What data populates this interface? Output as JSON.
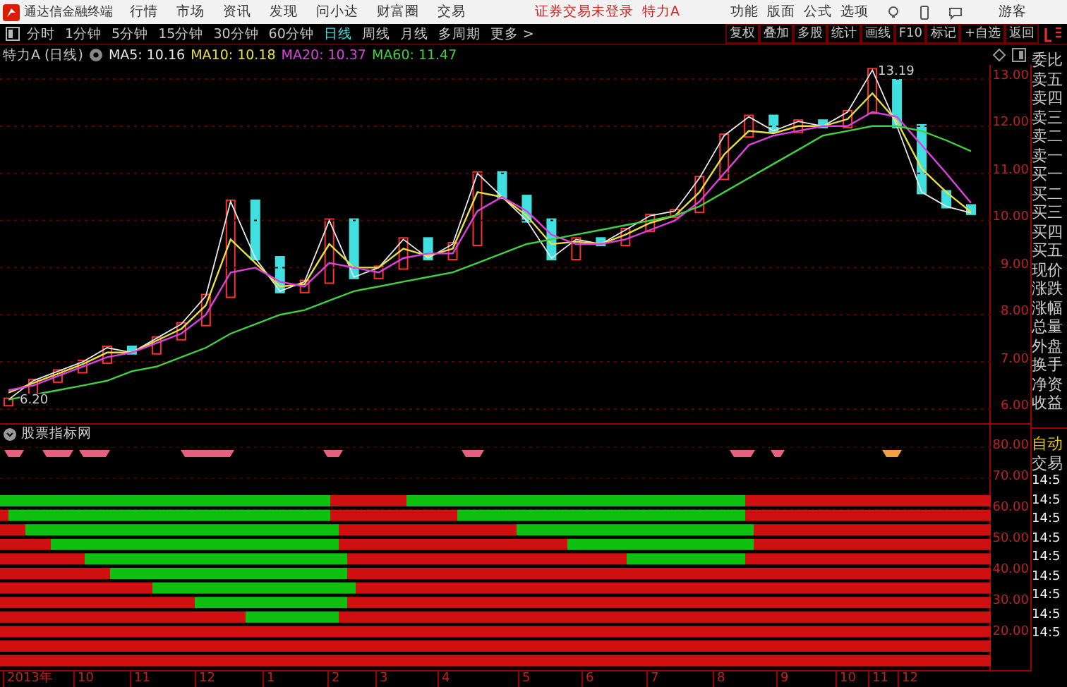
{
  "app": {
    "title": "通达信金融终端"
  },
  "menu": [
    "行情",
    "市场",
    "资讯",
    "发现",
    "问小达",
    "财富圈",
    "交易"
  ],
  "login_notice": "证券交易未登录",
  "stock_name": "特力A",
  "top_actions": [
    "功能",
    "版面",
    "公式",
    "选项"
  ],
  "user": "游客",
  "periods": [
    {
      "label": "分时",
      "selected": false
    },
    {
      "label": "1分钟",
      "selected": false
    },
    {
      "label": "5分钟",
      "selected": false
    },
    {
      "label": "15分钟",
      "selected": false
    },
    {
      "label": "30分钟",
      "selected": false
    },
    {
      "label": "60分钟",
      "selected": false
    },
    {
      "label": "日线",
      "selected": true
    },
    {
      "label": "周线",
      "selected": false
    },
    {
      "label": "月线",
      "selected": false
    },
    {
      "label": "多周期",
      "selected": false
    },
    {
      "label": "更多 >",
      "selected": false
    }
  ],
  "tools": [
    "复权",
    "叠加",
    "多股",
    "统计",
    "画线",
    "F10",
    "标记",
    "+自选",
    "返回"
  ],
  "legend": {
    "title": "特力A (日线)",
    "readings": [
      "10.16",
      "10.18",
      "10.37",
      "11.47"
    ]
  },
  "price_chart": {
    "chart_data": {
      "type": "line",
      "grid": true,
      "ylim": [
        5.7,
        13.3
      ],
      "yticks": [
        {
          "value": 13,
          "label": "13.00"
        },
        {
          "value": 12,
          "label": "12.00"
        },
        {
          "value": 11,
          "label": "11.00"
        },
        {
          "value": 10,
          "label": "10.00"
        },
        {
          "value": 9,
          "label": "9.00"
        },
        {
          "value": 8,
          "label": "8.00"
        },
        {
          "value": 7,
          "label": "7.00"
        },
        {
          "value": 6,
          "label": "6.00"
        }
      ],
      "series": [
        {
          "name": "MA5:",
          "color": "#e8e8e8",
          "values": [
            6.2,
            6.6,
            6.8,
            7.0,
            7.3,
            7.2,
            7.5,
            7.8,
            8.4,
            10.4,
            9.2,
            8.5,
            8.7,
            10.0,
            8.8,
            9.0,
            9.6,
            9.2,
            9.5,
            11.0,
            10.5,
            10.0,
            9.2,
            9.6,
            9.5,
            9.8,
            10.1,
            10.2,
            10.9,
            11.8,
            12.2,
            11.9,
            12.1,
            12.0,
            12.3,
            13.19,
            12.0,
            10.6,
            10.3,
            10.16
          ]
        },
        {
          "name": "MA10:",
          "color": "#e8e040",
          "values": [
            6.35,
            6.55,
            6.75,
            6.95,
            7.2,
            7.2,
            7.45,
            7.7,
            8.2,
            9.6,
            9.1,
            8.6,
            8.65,
            9.5,
            9.0,
            9.0,
            9.4,
            9.25,
            9.4,
            10.6,
            10.5,
            10.1,
            9.5,
            9.55,
            9.5,
            9.7,
            9.95,
            10.1,
            10.6,
            11.4,
            11.9,
            11.85,
            12.0,
            12.0,
            12.15,
            12.7,
            12.1,
            11.1,
            10.6,
            10.18
          ]
        },
        {
          "name": "MA20:",
          "color": "#e040e0",
          "values": [
            6.4,
            6.5,
            6.7,
            6.9,
            7.1,
            7.2,
            7.4,
            7.6,
            8.0,
            8.9,
            9.0,
            8.7,
            8.6,
            9.1,
            9.0,
            8.9,
            9.2,
            9.3,
            9.3,
            10.2,
            10.5,
            10.2,
            9.7,
            9.5,
            9.5,
            9.6,
            9.8,
            10.0,
            10.4,
            11.0,
            11.6,
            11.8,
            11.9,
            12.0,
            12.0,
            12.3,
            12.2,
            11.6,
            11.0,
            10.37
          ]
        },
        {
          "name": "MA60:",
          "color": "#40d040",
          "values": [
            6.2,
            6.3,
            6.4,
            6.5,
            6.6,
            6.8,
            6.9,
            7.1,
            7.3,
            7.6,
            7.8,
            8.0,
            8.1,
            8.3,
            8.5,
            8.6,
            8.7,
            8.8,
            8.9,
            9.1,
            9.3,
            9.5,
            9.6,
            9.7,
            9.8,
            9.9,
            10.0,
            10.1,
            10.3,
            10.6,
            10.9,
            11.2,
            11.5,
            11.8,
            11.9,
            12.0,
            12.0,
            11.9,
            11.7,
            11.47
          ]
        }
      ],
      "annotations": [
        "13.19",
        "6.20"
      ]
    }
  },
  "indicator": {
    "title": "股票指标网",
    "axis": [
      "80.00",
      "70.00",
      "60.00",
      "50.00",
      "40.00",
      "30.00",
      "20.00"
    ]
  },
  "x_axis": [
    "2013年",
    "10",
    "11",
    "12",
    "1",
    "2",
    "3",
    "4",
    "5",
    "6",
    "7",
    "8",
    "9",
    "10",
    "11",
    "12"
  ],
  "quote_labels": [
    "委比",
    "卖五",
    "卖四",
    "卖三",
    "卖二",
    "卖一",
    "买一",
    "买二",
    "买三",
    "买四",
    "买五",
    "现价",
    "涨跌",
    "涨幅",
    "总量",
    "外盘",
    "换手",
    "净资",
    "收益"
  ],
  "trade_panel": {
    "auto": "自动",
    "trade": "交易",
    "times": [
      "14:5",
      "14:5",
      "14:5",
      "14:5",
      "14:5",
      "14:5",
      "14:5",
      "14:5",
      "14:5"
    ]
  }
}
